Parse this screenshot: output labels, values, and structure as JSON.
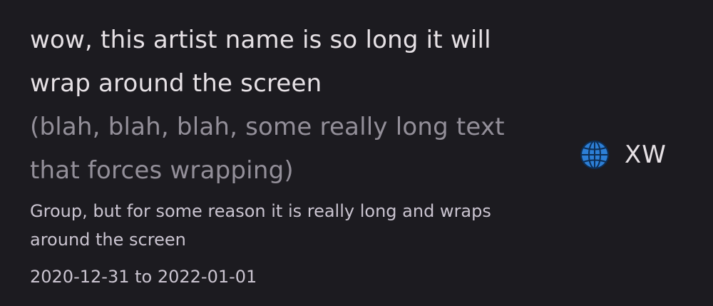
{
  "artist": {
    "name": "wow, this artist name is so long it will wrap around the screen",
    "disambiguation": "(blah, blah, blah, some really long text that forces wrapping)",
    "type_line": "Group, but for some reason it is really long and wraps around the screen",
    "dates": "2020-12-31 to 2022-01-01",
    "country": {
      "icon": "globe-icon",
      "code": "XW"
    }
  },
  "colors": {
    "background": "#1c1b20",
    "primary_text": "#e6e1e5",
    "secondary_text": "#938f99",
    "globe_blue": "#2d7fd6"
  }
}
